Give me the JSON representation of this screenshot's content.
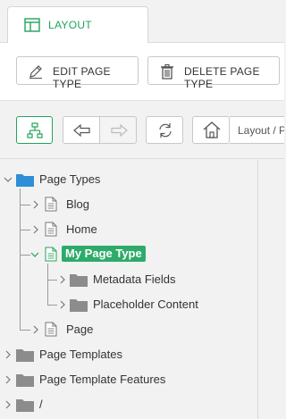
{
  "tab": {
    "label": "LAYOUT",
    "icon": "layout-icon"
  },
  "toolbar": {
    "edit_label": "EDIT PAGE TYPE",
    "delete_label": "DELETE PAGE TYPE"
  },
  "navbar": {
    "breadcrumb": "Layout / P"
  },
  "tree": {
    "root": "Page Types",
    "children": [
      "Blog",
      "Home",
      "My Page Type",
      "Page"
    ],
    "selected_children": [
      "Metadata Fields",
      "Placeholder Content"
    ],
    "siblings": [
      "Page Templates",
      "Page Template Features",
      "/"
    ]
  },
  "colors": {
    "accent": "#22a35b",
    "selected_bg": "#2eab6a",
    "folder_blue": "#2f8ed8",
    "folder_gray": "#8c8c8c"
  }
}
